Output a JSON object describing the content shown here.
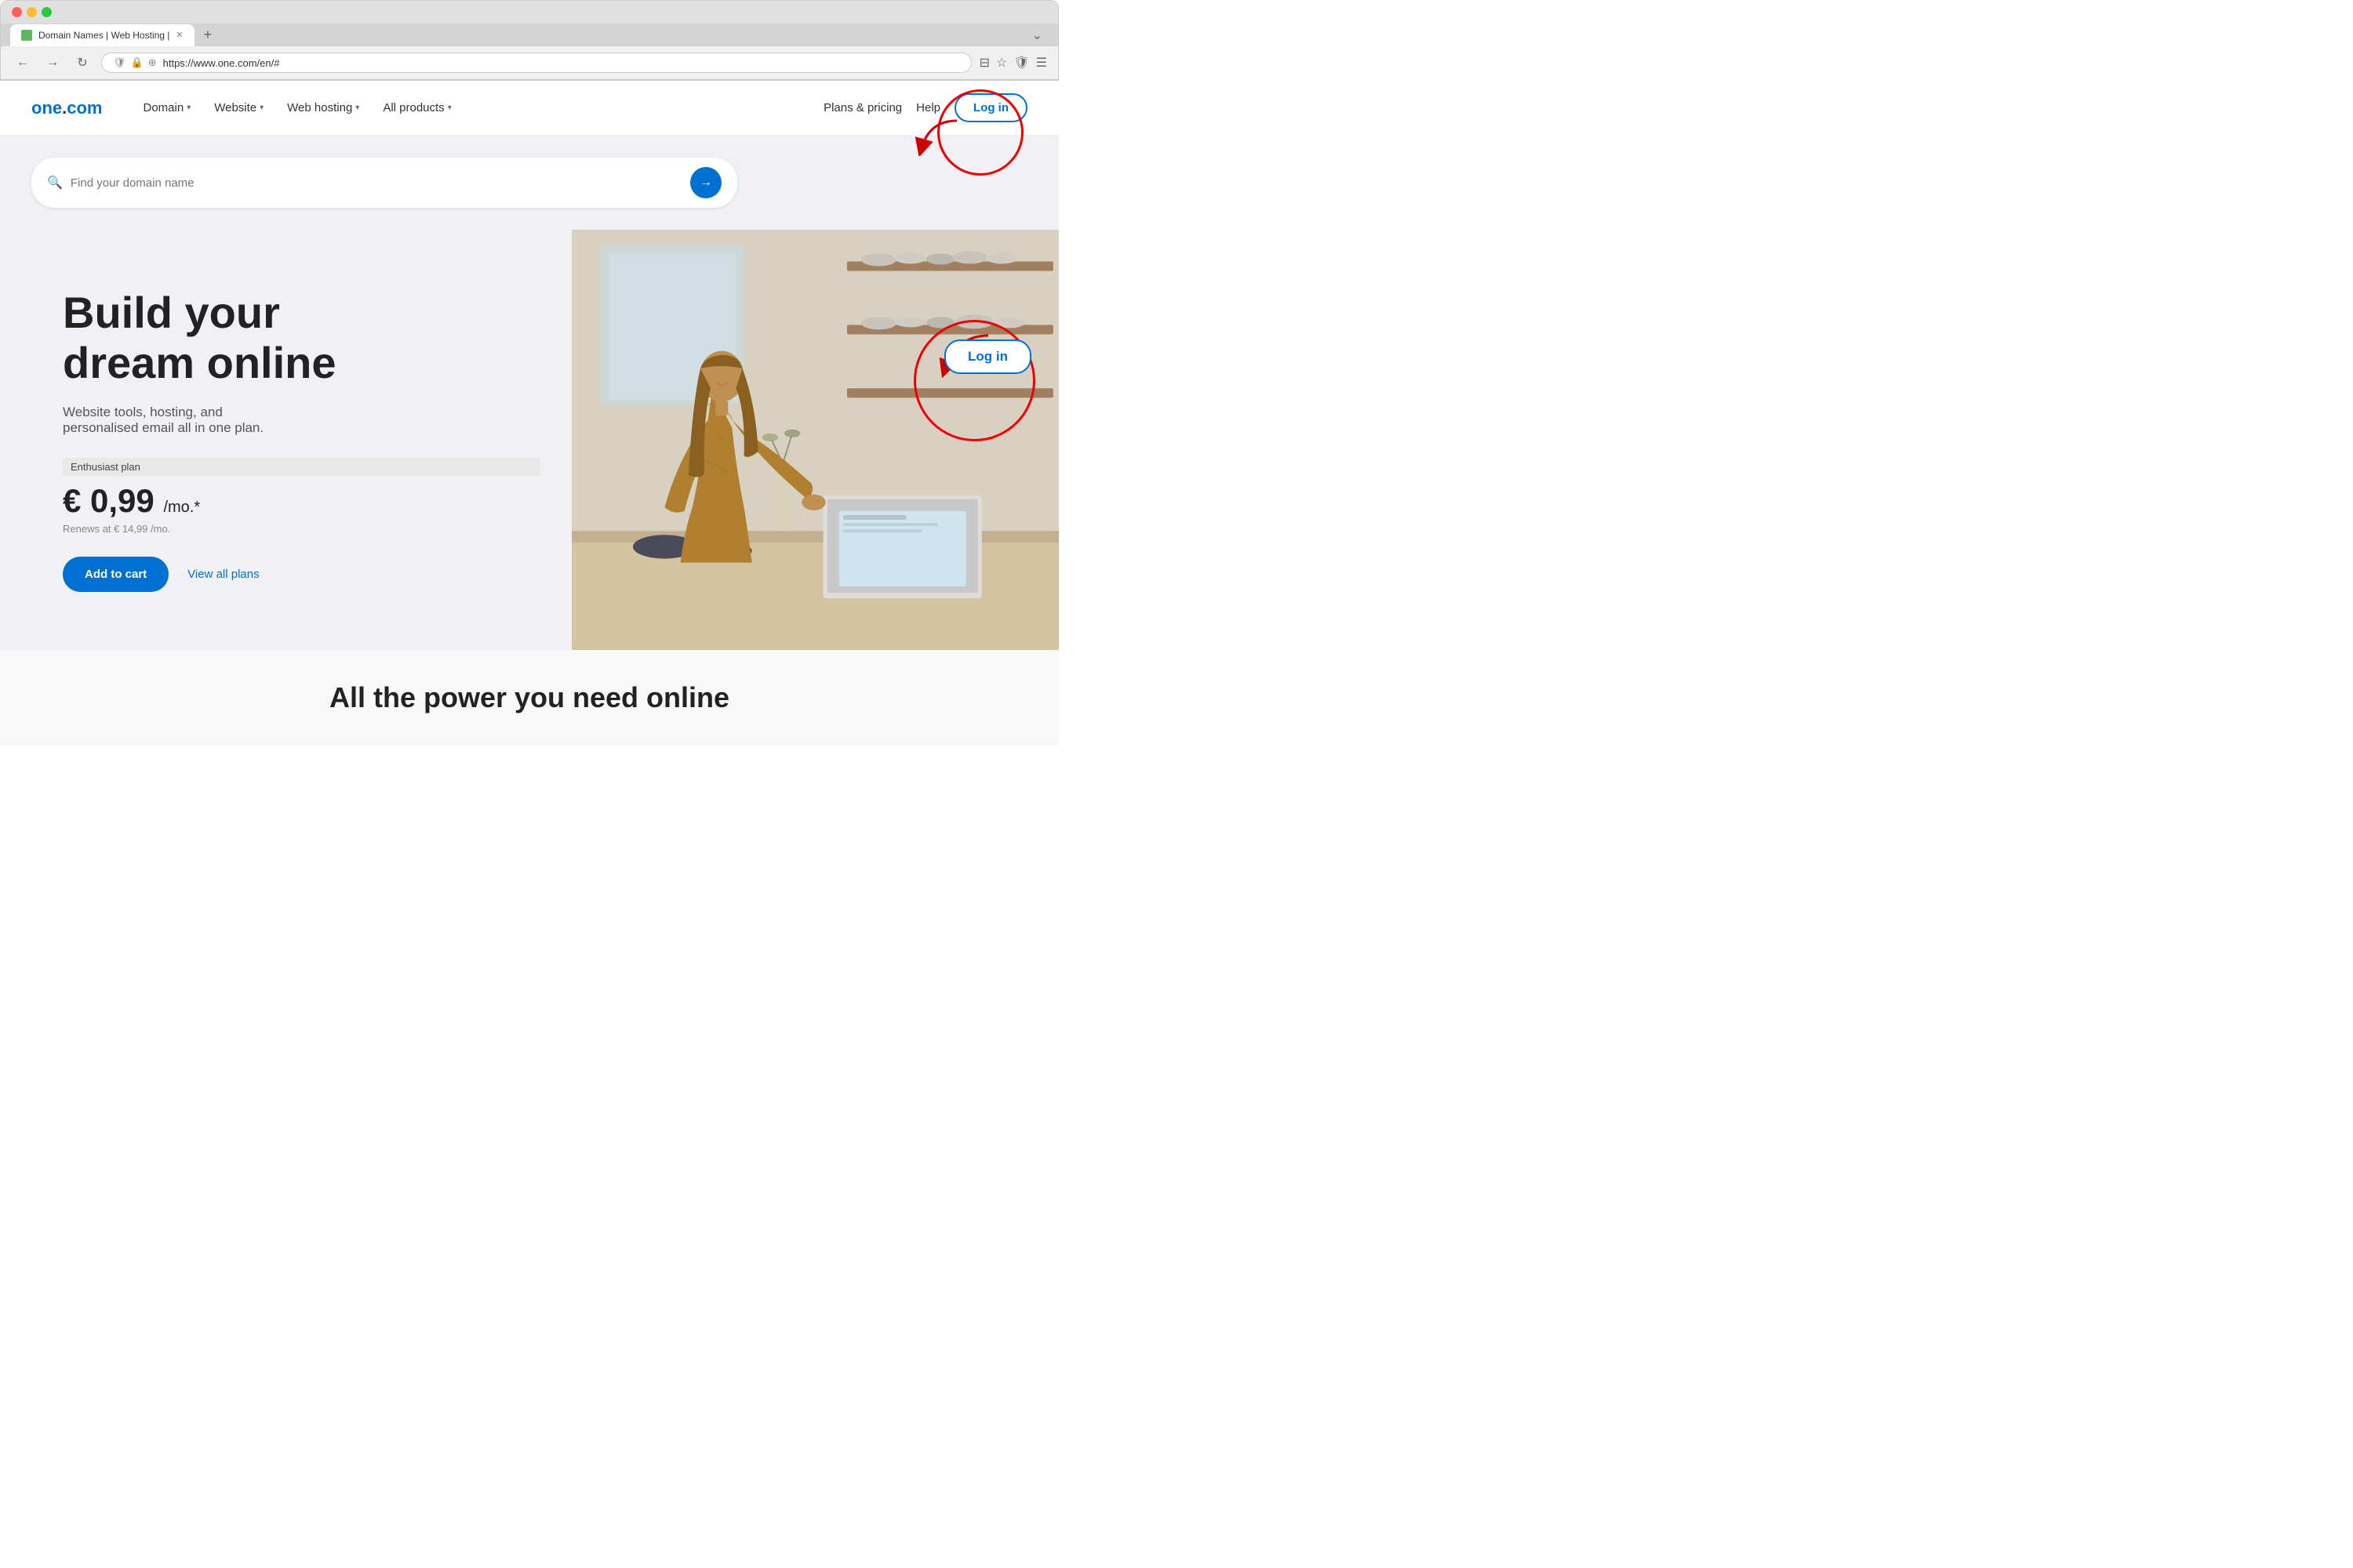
{
  "browser": {
    "tab_label": "Domain Names | Web Hosting |",
    "tab_new": "+",
    "url": "https://www.one.com/en/#",
    "nav_back": "←",
    "nav_forward": "→",
    "nav_refresh": "↻"
  },
  "header": {
    "logo_text": "one.com",
    "nav_items": [
      {
        "label": "Domain",
        "has_chevron": true
      },
      {
        "label": "Website",
        "has_chevron": true
      },
      {
        "label": "Web hosting",
        "has_chevron": true
      },
      {
        "label": "All products",
        "has_chevron": true
      }
    ],
    "plans_pricing": "Plans & pricing",
    "help": "Help",
    "login": "Log in"
  },
  "search": {
    "placeholder": "Find your domain name"
  },
  "hero": {
    "title_line1": "Build your",
    "title_line2": "dream online",
    "subtitle": "Website tools, hosting, and\npersonalised email all in one plan.",
    "plan_badge": "Enthusiast plan",
    "price": "€ 0,99",
    "price_period": "/mo.*",
    "price_renew": "Renews at € 14,99 /mo.",
    "btn_cart": "Add to cart",
    "btn_plans": "View all plans"
  },
  "annotation": {
    "login_zoom_label": "Log in"
  },
  "bottom": {
    "teaser_title": "All the power you need online"
  }
}
